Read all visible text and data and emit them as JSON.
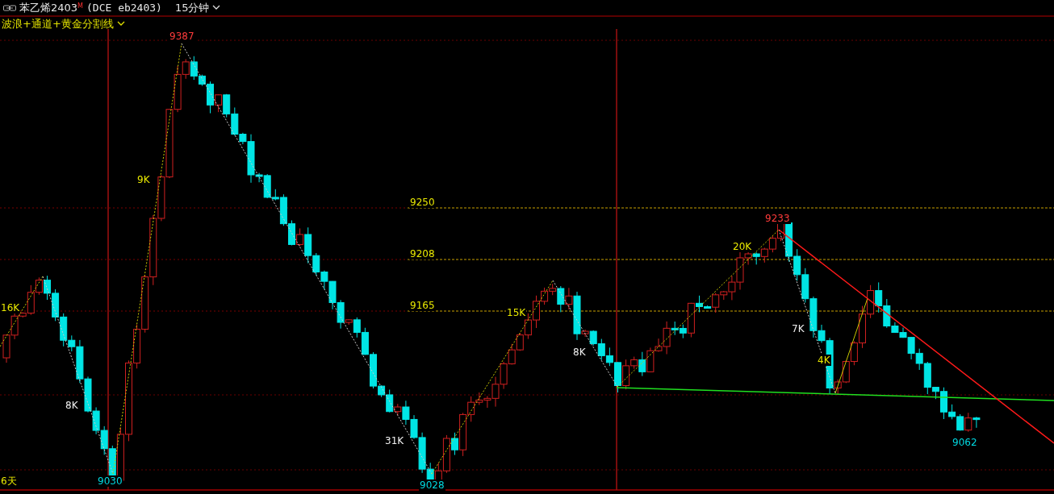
{
  "header": {
    "title": "苯乙烯2403",
    "title_mark": "M",
    "contract": "(DCE eb2403)",
    "period": "15分钟"
  },
  "indicator": {
    "label": "波浪+通道+黄金分割线"
  },
  "chart_labels": [
    {
      "text": "9387",
      "kind": "peak"
    },
    {
      "text": "9030",
      "kind": "trough"
    },
    {
      "text": "9028",
      "kind": "trough"
    },
    {
      "text": "9233",
      "kind": "peak"
    },
    {
      "text": "9062",
      "kind": "trough"
    },
    {
      "text": "16K",
      "kind": "wave_up"
    },
    {
      "text": "8K",
      "kind": "wave_down"
    },
    {
      "text": "9K",
      "kind": "wave_up"
    },
    {
      "text": "31K",
      "kind": "wave_down"
    },
    {
      "text": "15K",
      "kind": "wave_up"
    },
    {
      "text": "8K",
      "kind": "wave_down"
    },
    {
      "text": "20K",
      "kind": "wave_up"
    },
    {
      "text": "7K",
      "kind": "wave_down"
    },
    {
      "text": "4K",
      "kind": "wave_up"
    },
    {
      "text": "9250",
      "kind": "level"
    },
    {
      "text": "9208",
      "kind": "level"
    },
    {
      "text": "9165",
      "kind": "level"
    },
    {
      "text": "6天",
      "kind": "level"
    }
  ]
}
